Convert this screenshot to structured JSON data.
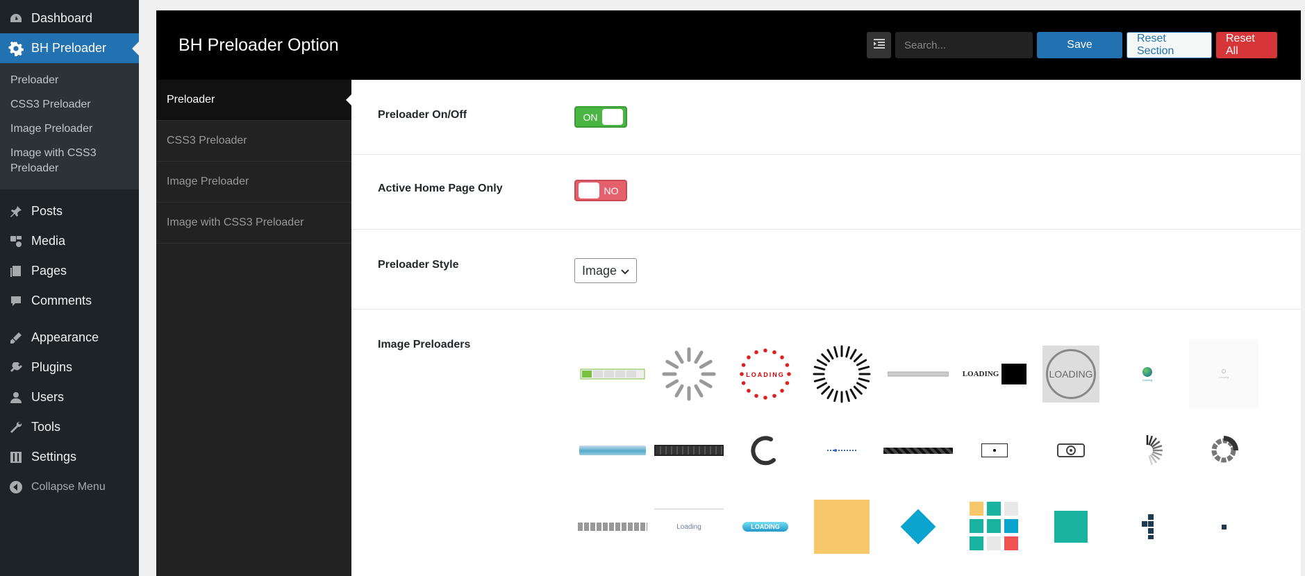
{
  "sidebar": {
    "items": [
      {
        "label": "Dashboard",
        "icon": "dashboard-icon"
      },
      {
        "label": "BH Preloader",
        "icon": "gear-icon",
        "current": true
      },
      {
        "label": "Posts",
        "icon": "pin-icon"
      },
      {
        "label": "Media",
        "icon": "media-icon"
      },
      {
        "label": "Pages",
        "icon": "pages-icon"
      },
      {
        "label": "Comments",
        "icon": "comment-icon"
      },
      {
        "label": "Appearance",
        "icon": "brush-icon"
      },
      {
        "label": "Plugins",
        "icon": "plug-icon"
      },
      {
        "label": "Users",
        "icon": "user-icon"
      },
      {
        "label": "Tools",
        "icon": "wrench-icon"
      },
      {
        "label": "Settings",
        "icon": "sliders-icon"
      },
      {
        "label": "Collapse Menu",
        "icon": "collapse-icon"
      }
    ],
    "submenu": [
      "Preloader",
      "CSS3 Preloader",
      "Image Preloader",
      "Image with CSS3 Preloader"
    ]
  },
  "panel": {
    "title": "BH Preloader Option",
    "search_placeholder": "Search...",
    "save_label": "Save",
    "reset_section_label": "Reset Section",
    "reset_all_label": "Reset All"
  },
  "tabs": [
    "Preloader",
    "CSS3 Preloader",
    "Image Preloader",
    "Image with CSS3 Preloader"
  ],
  "fields": {
    "onoff_label": "Preloader On/Off",
    "onoff_value": "ON",
    "homepage_label": "Active Home Page Only",
    "homepage_value": "NO",
    "style_label": "Preloader Style",
    "style_value": "Image",
    "images_label": "Image Preloaders"
  },
  "preloader_texts": {
    "loading_lower": "Loading",
    "loading_upper": "LOADING"
  },
  "colors": {
    "wp_blue": "#2271b1",
    "toggle_on": "#4bb543",
    "toggle_off": "#e4606d",
    "danger": "#d63638"
  }
}
